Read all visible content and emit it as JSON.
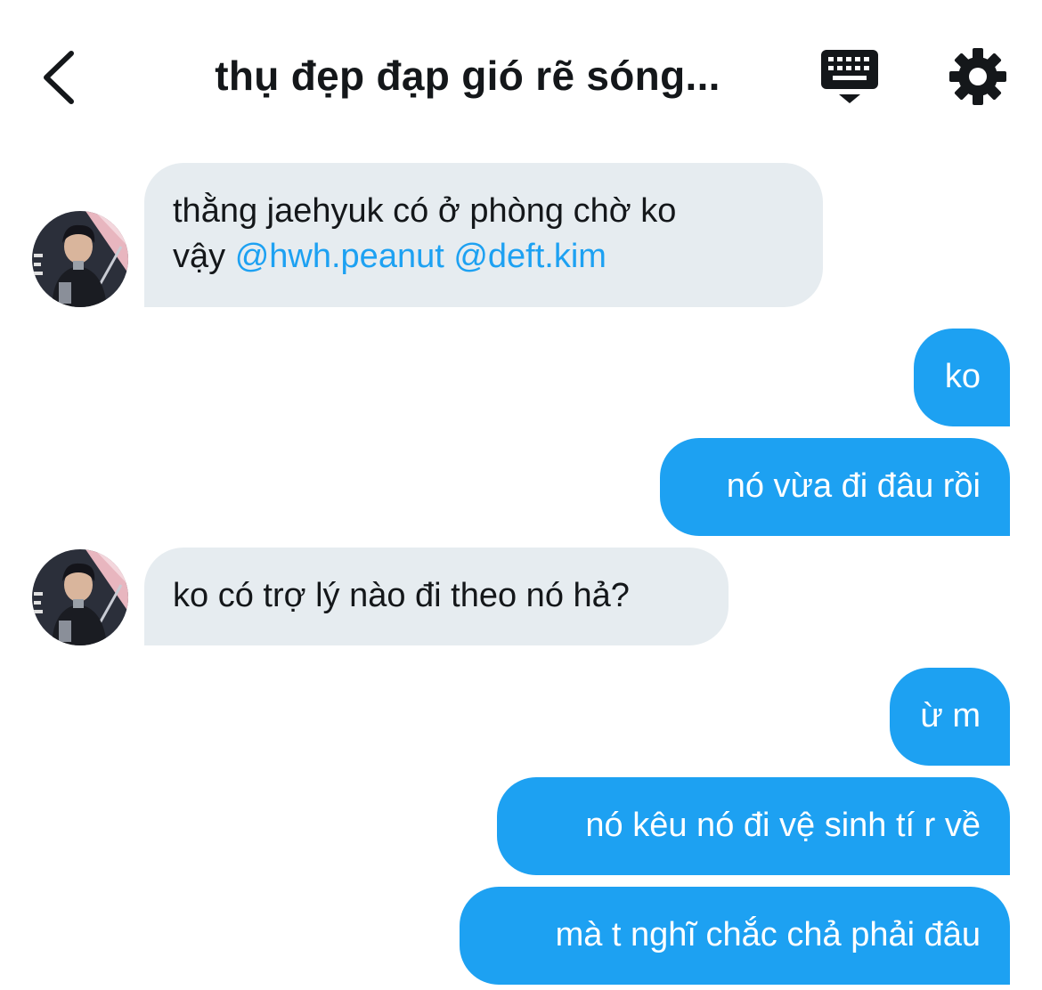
{
  "header": {
    "title": "thụ đẹp đạp gió rẽ sóng...",
    "back_icon": "chevron-left-icon",
    "keyboard_icon": "keyboard-icon",
    "settings_icon": "gear-icon"
  },
  "colors": {
    "accent": "#1da1f2",
    "incoming_bubble": "#e6ecf0",
    "text": "#14171a"
  },
  "messages": [
    {
      "direction": "incoming",
      "line1": "thằng jaehyuk có ở phòng chờ ko",
      "line2_text": "vậy ",
      "mention1": "@hwh.peanut",
      "mention2": "@deft.kim"
    },
    {
      "direction": "outgoing",
      "text": "ko"
    },
    {
      "direction": "outgoing",
      "text": "nó vừa đi đâu rồi"
    },
    {
      "direction": "incoming",
      "text": "ko có trợ lý nào đi theo nó hả?"
    },
    {
      "direction": "outgoing",
      "text": "ừ m"
    },
    {
      "direction": "outgoing",
      "text": "nó kêu nó đi vệ sinh tí r về"
    },
    {
      "direction": "outgoing",
      "text": "mà t nghĩ chắc chả phải đâu"
    }
  ]
}
